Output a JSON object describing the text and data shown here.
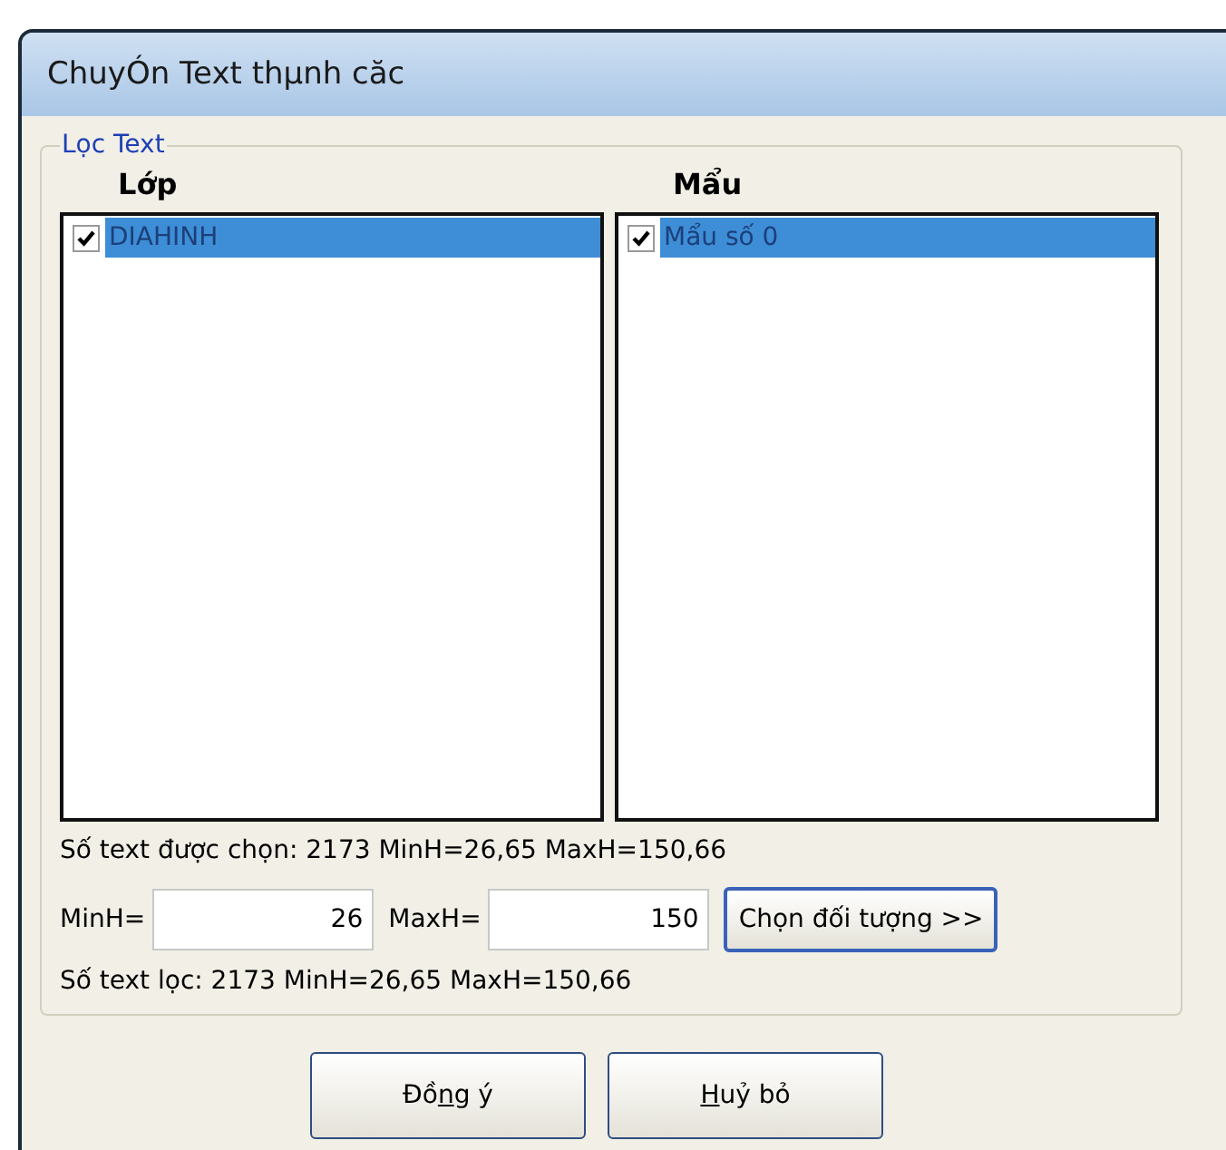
{
  "window": {
    "title": "ChuyÓn Text thµnh căc"
  },
  "group": {
    "title": "Lọc Text",
    "lists": [
      {
        "heading": "Lớp",
        "items": [
          {
            "label": "DIAHINH",
            "checked": true,
            "selected": true
          }
        ]
      },
      {
        "heading": "Mẩu",
        "items": [
          {
            "label": "Mẩu số 0",
            "checked": true,
            "selected": true
          }
        ]
      }
    ],
    "selected_info": "Số text được chọn: 2173 MinH=26,65 MaxH=150,66",
    "min_label": "MinH=",
    "min_value": "26",
    "max_label": "MaxH=",
    "max_value": "150",
    "pick_button": "Chọn đối tượng >>",
    "filtered_info": "Số text lọc: 2173 MinH=26,65 MaxH=150,66"
  },
  "buttons": [
    {
      "pre": "Đồ",
      "key": "n",
      "post": "g ý"
    },
    {
      "key": "H",
      "post": "uỷ bỏ"
    }
  ]
}
